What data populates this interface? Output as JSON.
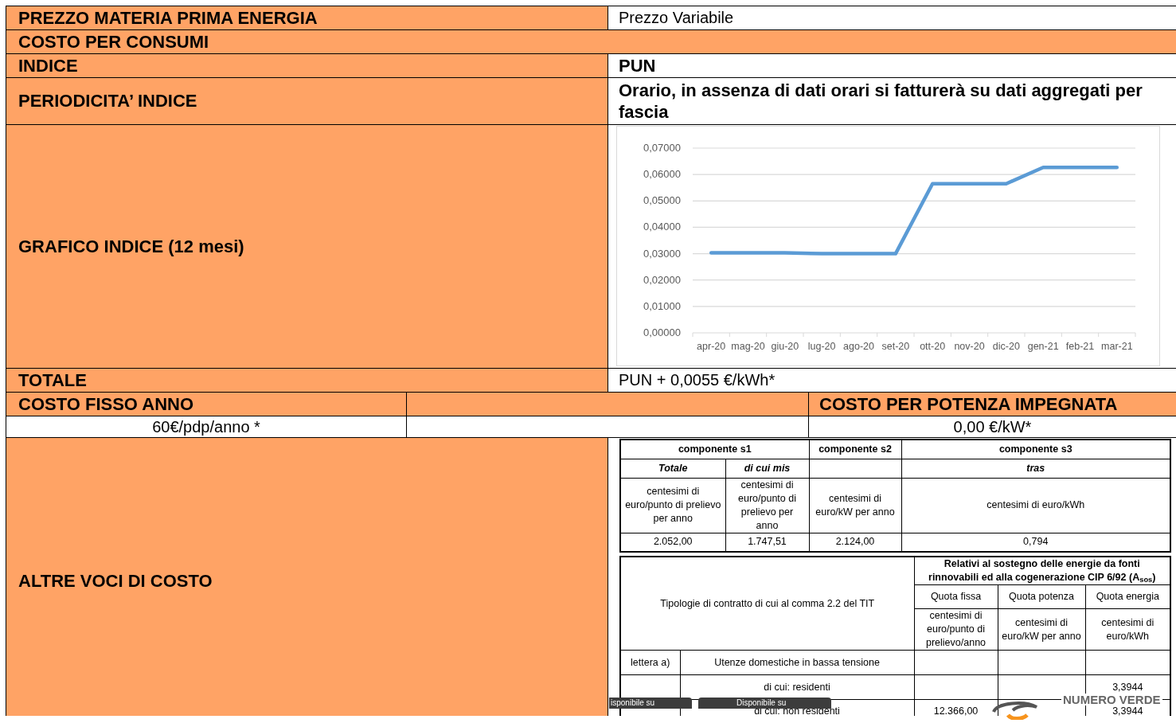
{
  "price": {
    "label": "PREZZO MATERIA PRIMA ENERGIA",
    "value": "Prezzo Variabile"
  },
  "section_title": "COSTO PER CONSUMI",
  "index": {
    "label": "INDICE",
    "value": "PUN"
  },
  "index_period": {
    "label": "PERIODICITA’ INDICE",
    "value": "Orario, in assenza di dati orari si fatturerà su dati aggregati per fascia"
  },
  "index_chart": {
    "label": "GRAFICO INDICE (12 mesi)",
    "chart_data": {
      "type": "line",
      "categories": [
        "apr-20",
        "mag-20",
        "giu-20",
        "lug-20",
        "ago-20",
        "set-20",
        "ott-20",
        "nov-20",
        "dic-20",
        "gen-21",
        "feb-21",
        "mar-21"
      ],
      "grid": true,
      "series": [
        {
          "color": "#5b9bd5",
          "values": [
            0.0303,
            0.0303,
            0.0303,
            0.03,
            0.03,
            0.03,
            0.0565,
            0.0565,
            0.0565,
            0.0627,
            0.0627,
            0.0627
          ]
        }
      ],
      "ylim": [
        0,
        0.07
      ],
      "yticks": [
        {
          "value": 0,
          "label": "0,00000"
        },
        {
          "value": 0.01,
          "label": "0,01000"
        },
        {
          "value": 0.02,
          "label": "0,02000"
        },
        {
          "value": 0.03,
          "label": "0,03000"
        },
        {
          "value": 0.04,
          "label": "0,04000"
        },
        {
          "value": 0.05,
          "label": "0,05000"
        },
        {
          "value": 0.06,
          "label": "0,06000"
        },
        {
          "value": 0.07,
          "label": "0,07000"
        }
      ]
    }
  },
  "total": {
    "label": "TOTALE",
    "value": "PUN + 0,0055 €/kWh*"
  },
  "fixed_cost": {
    "label": "COSTO FISSO ANNO",
    "value": "60€/pdp/anno *"
  },
  "power_cost": {
    "label": "COSTO PER POTENZA IMPEGNATA",
    "value": "0,00 €/kW*"
  },
  "other_costs": {
    "label": "ALTRE VOCI DI COSTO",
    "components_table": {
      "groups": [
        "componente s1",
        "componente s2",
        "componente s3"
      ],
      "subheaders": [
        "Totale",
        "di cui mis",
        "tras"
      ],
      "units": [
        "centesimi di euro/punto di prelievo per anno",
        "centesimi di euro/punto di prelievo per anno",
        "centesimi di euro/kW per anno",
        "centesimi di euro/kWh"
      ],
      "values": [
        "2.052,00",
        "1.747,51",
        "2.124,00",
        "0,794"
      ]
    },
    "asos_table": {
      "left_header": "Tipologie di contratto di cui al comma 2.2 del TIT",
      "group_header": "Relativi al sostegno delle energie da fonti rinnovabili ed alla cogenerazione CIP 6/92 (A$_{sos}$)",
      "columns": [
        null,
        null,
        "Quota fissa",
        "Quota potenza",
        "Quota energia"
      ],
      "units": [
        "centesimi di euro/punto di prelievo/anno",
        "centesimi di euro/kW per anno",
        "centesimi di euro/kWh"
      ],
      "rows": [
        [
          "lettera a)",
          "Utenze domestiche in bassa tensione",
          "",
          "",
          ""
        ],
        [
          "",
          "di cui: residenti",
          "",
          "",
          "3,3944"
        ],
        [
          "",
          "di cui: non residenti",
          "12.366,00",
          "",
          "3,3944"
        ]
      ]
    }
  },
  "overlays": {
    "app_store": {
      "caption": "isponibile su"
    },
    "google_play": {
      "caption": "Disponibile su"
    },
    "toll_free": {
      "title": "NUMERO VERDE"
    }
  }
}
